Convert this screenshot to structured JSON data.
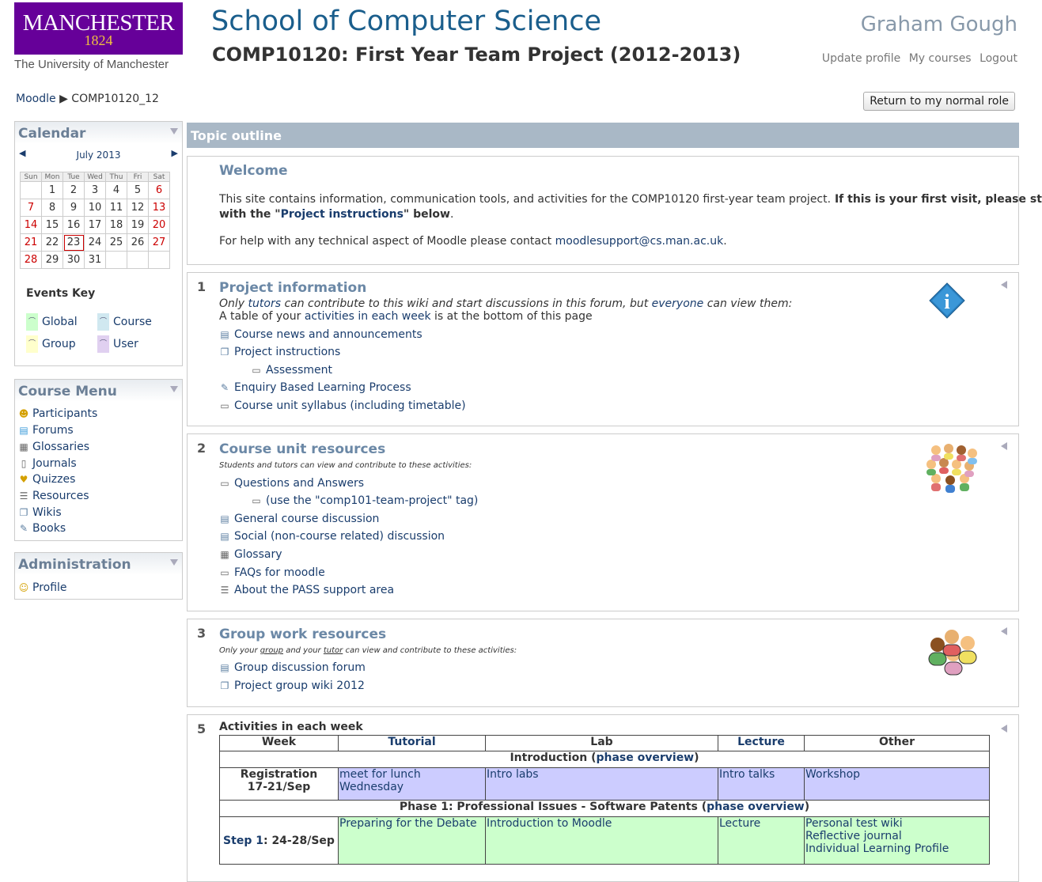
{
  "header": {
    "logo_line1": "MANCHESTER",
    "logo_line2": "1824",
    "logo_sub": "The University of Manchester",
    "school": "School of Computer Science",
    "course_title": "COMP10120: First Year Team Project (2012-2013)",
    "user_name": "Graham Gough",
    "links": [
      "Update profile",
      "My courses",
      "Logout"
    ]
  },
  "breadcrumb": {
    "root": "Moodle",
    "sep": "▶",
    "current": "COMP10120_12"
  },
  "role_button": "Return to my normal role",
  "calendar": {
    "title": "Calendar",
    "month": "July 2013",
    "prev": "◀",
    "next": "▶",
    "days": [
      "Sun",
      "Mon",
      "Tue",
      "Wed",
      "Thu",
      "Fri",
      "Sat"
    ],
    "weeks": [
      [
        "",
        "1",
        "2",
        "3",
        "4",
        "5",
        "6"
      ],
      [
        "7",
        "8",
        "9",
        "10",
        "11",
        "12",
        "13"
      ],
      [
        "14",
        "15",
        "16",
        "17",
        "18",
        "19",
        "20"
      ],
      [
        "21",
        "22",
        "23",
        "24",
        "25",
        "26",
        "27"
      ],
      [
        "28",
        "29",
        "30",
        "31",
        "",
        "",
        ""
      ]
    ],
    "today": "23",
    "events_key_title": "Events Key",
    "events_key": [
      {
        "label": "Global",
        "color": "#ccffcc"
      },
      {
        "label": "Course",
        "color": "#d0e8f0"
      },
      {
        "label": "Group",
        "color": "#ffffcc"
      },
      {
        "label": "User",
        "color": "#e0d0f0"
      }
    ]
  },
  "course_menu": {
    "title": "Course Menu",
    "items": [
      {
        "label": "Participants",
        "icon": "participants-icon"
      },
      {
        "label": "Forums",
        "icon": "forum-icon"
      },
      {
        "label": "Glossaries",
        "icon": "glossary-icon"
      },
      {
        "label": "Journals",
        "icon": "journal-icon"
      },
      {
        "label": "Quizzes",
        "icon": "quiz-icon"
      },
      {
        "label": "Resources",
        "icon": "resource-icon"
      },
      {
        "label": "Wikis",
        "icon": "wiki-icon"
      },
      {
        "label": "Books",
        "icon": "book-icon"
      }
    ]
  },
  "administration": {
    "title": "Administration",
    "items": [
      {
        "label": "Profile",
        "icon": "profile-icon"
      }
    ]
  },
  "topic_outline": "Topic outline",
  "welcome": {
    "title": "Welcome",
    "p1_a": "This site contains information, communication tools, and activities for the COMP10120 first-year team project.",
    "p1_b": " If this is your first visit, please start",
    "p1_c": "with the \"",
    "p1_link": "Project instructions",
    "p1_d": "\" below",
    "p1_e": ".",
    "p2_a": "For help with any technical aspect of Moodle please contact ",
    "p2_link": "moodlesupport@cs.man.ac.uk",
    "p2_b": "."
  },
  "section1": {
    "num": "1",
    "title": "Project information",
    "line1_a": "Only ",
    "line1_b": "tutors",
    "line1_c": " can contribute to this wiki and start discussions in this forum, but ",
    "line1_d": "everyone",
    "line1_e": " can view them:",
    "line2_a": "A table of your ",
    "line2_b": "activities in each week",
    "line2_c": " is at the bottom of this page",
    "activities": [
      {
        "label": "Course news and announcements",
        "icon": "forum-icon"
      },
      {
        "label": "Project instructions",
        "icon": "wiki-icon"
      },
      {
        "label": "Assessment",
        "icon": "resource-icon"
      },
      {
        "label": "Enquiry Based Learning Process",
        "icon": "book-icon"
      },
      {
        "label": "Course unit syllabus (including timetable)",
        "icon": "resource-icon"
      }
    ]
  },
  "section2": {
    "num": "2",
    "title": "Course unit resources",
    "note_a": "Students",
    "note_b": " and ",
    "note_c": "tutors",
    "note_d": " can view and contribute to these activities:",
    "activities": [
      {
        "label": "Questions and Answers",
        "icon": "resource-icon"
      },
      {
        "label": "(use the \"comp101-team-project\" tag)",
        "icon": "resource-icon"
      },
      {
        "label": "General course discussion",
        "icon": "forum-icon"
      },
      {
        "label": "Social (non-course related) discussion",
        "icon": "forum-icon"
      },
      {
        "label": "Glossary",
        "icon": "glossary-icon"
      },
      {
        "label": "FAQs for moodle",
        "icon": "resource-icon"
      },
      {
        "label": "About the PASS support area",
        "icon": "resource-icon"
      }
    ]
  },
  "section3": {
    "num": "3",
    "title": "Group work resources",
    "note_a": "Only your ",
    "note_b": "group",
    "note_c": " and your ",
    "note_d": "tutor",
    "note_e": " can view and contribute to these activities:",
    "activities": [
      {
        "label": "Group discussion forum",
        "icon": "forum-icon"
      },
      {
        "label": "Project group wiki 2012",
        "icon": "wiki-icon"
      }
    ]
  },
  "section5": {
    "num": "5",
    "title": "Activities in each week",
    "headers": [
      "Week",
      "Tutorial",
      "Lab",
      "Lecture",
      "Other"
    ],
    "intro_a": "Introduction (",
    "intro_link": "phase overview",
    "intro_b": ")",
    "reg_week_1": "Registration",
    "reg_week_2": "17-21/Sep",
    "reg_tutorial": "meet for lunch Wednesday",
    "reg_lab": "Intro labs",
    "reg_lecture": "Intro talks",
    "reg_other": "Workshop",
    "phase1_a": "Phase 1: Professional Issues - Software Patents (",
    "phase1_link": "phase overview",
    "phase1_b": ")",
    "step1_a": "Step 1",
    "step1_b": ": 24-28/Sep",
    "step1_tutorial": "Preparing for the Debate",
    "step1_lab": "Introduction to Moodle",
    "step1_lecture": "Lecture",
    "step1_other": [
      "Personal test wiki",
      "Reflective journal",
      "Individual Learning Profile"
    ]
  }
}
